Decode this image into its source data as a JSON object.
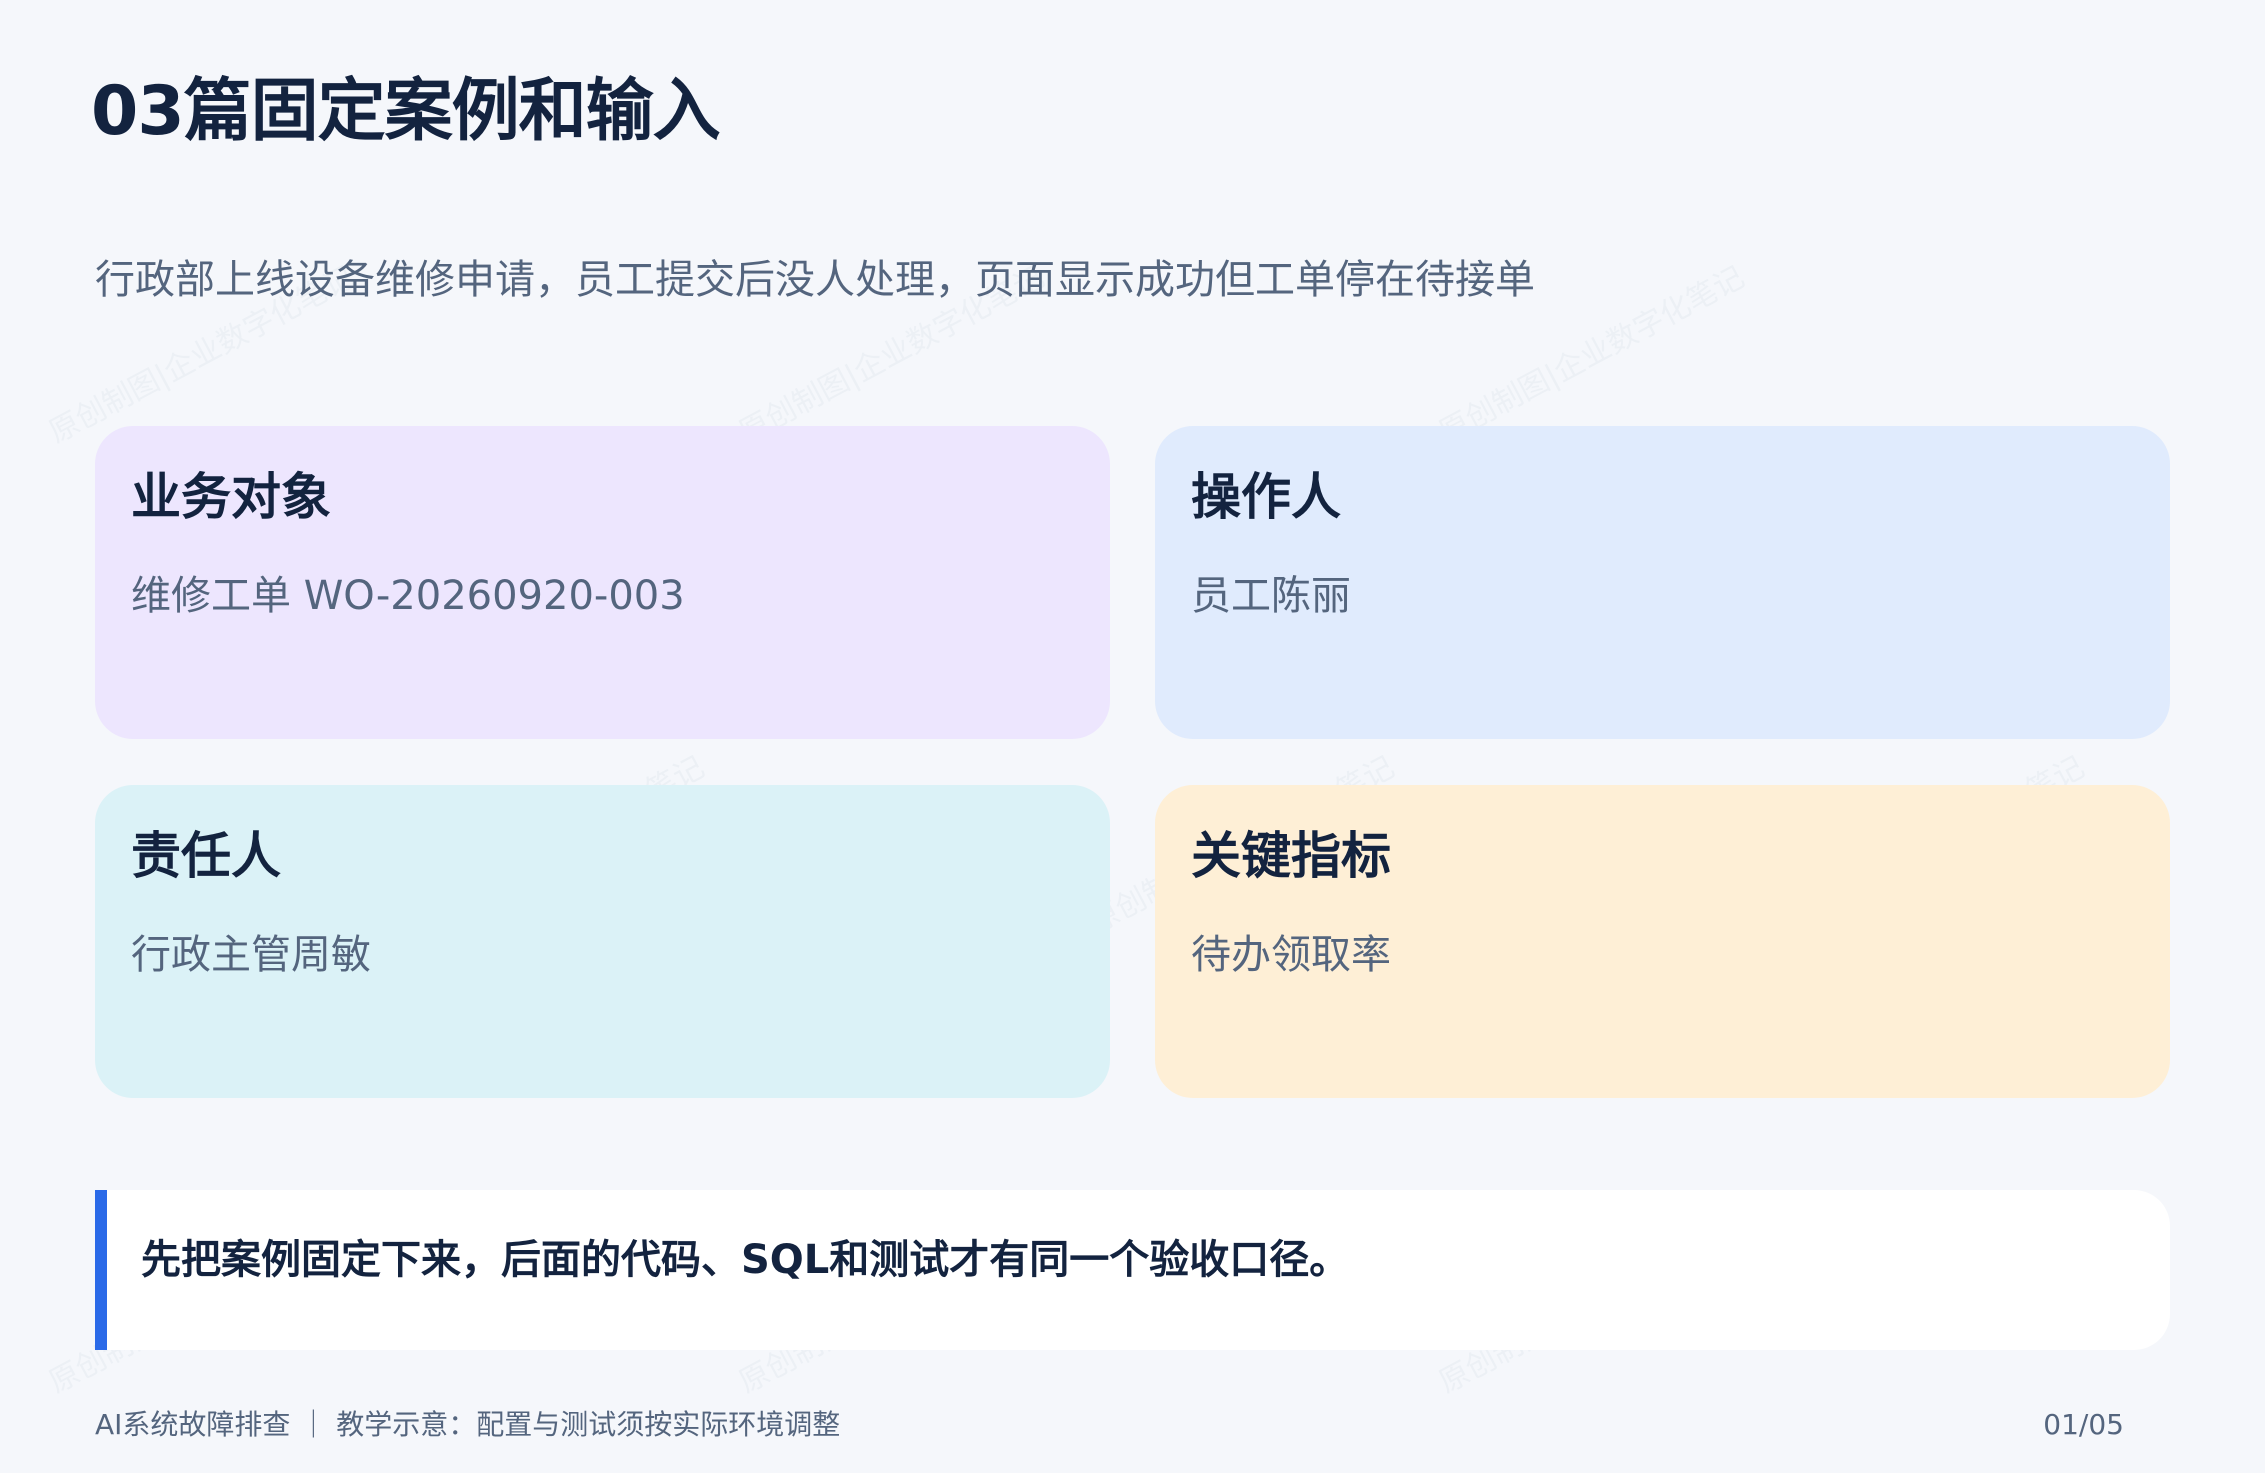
{
  "page": {
    "title": "03篇固定案例和输入",
    "subtitle": "行政部上线设备维修申请，员工提交后没人处理，页面显示成功但工单停在待接单"
  },
  "cards": [
    {
      "heading": "业务对象",
      "value": "维修工单 WO-20260920-003",
      "color": "#ede6fe"
    },
    {
      "heading": "操作人",
      "value": "员工陈丽",
      "color": "#e0ebfd"
    },
    {
      "heading": "责任人",
      "value": "行政主管周敏",
      "color": "#dbf2f7"
    },
    {
      "heading": "关键指标",
      "value": "待办领取率",
      "color": "#feefd6"
    }
  ],
  "callout": {
    "text": "先把案例固定下来，后面的代码、SQL和测试才有同一个验收口径。",
    "accent": "#2a6ae8"
  },
  "footer": {
    "left": "AI系统故障排查 ｜ 教学示意：配置与测试须按实际环境调整",
    "page_indicator": "01/05"
  },
  "watermark": "原创制图|企业数字化笔记"
}
